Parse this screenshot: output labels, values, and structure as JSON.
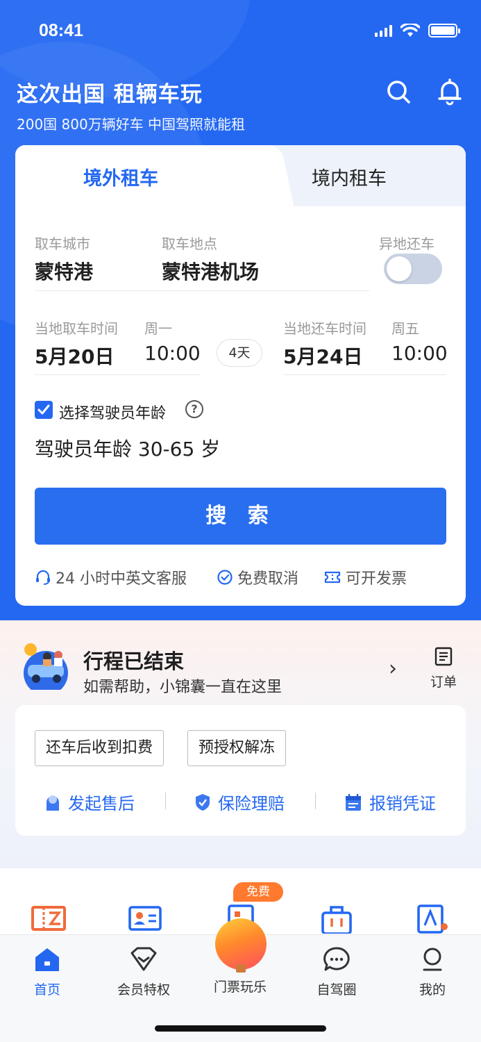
{
  "status": {
    "time": "08:41"
  },
  "header": {
    "title": "这次出国 租辆车玩",
    "subtitle": "200国 800万辆好车 中国驾照就能租"
  },
  "tabs": {
    "overseas": "境外租车",
    "domestic": "境内租车"
  },
  "form": {
    "city_label": "取车城市",
    "city_value": "蒙特港",
    "location_label": "取车地点",
    "location_value": "蒙特港机场",
    "diff_return_label": "异地还车",
    "diff_return_on": false,
    "pickup_time_label": "当地取车时间",
    "pickup_weekday": "周一",
    "pickup_date": "5月20日",
    "pickup_time": "10:00",
    "duration": "4天",
    "return_time_label": "当地还车时间",
    "return_weekday": "周五",
    "return_date": "5月24日",
    "return_time": "10:00",
    "age_checkbox_label": "选择驾驶员年龄",
    "age_checked": true,
    "age_text": "驾驶员年龄 30-65 岁",
    "search_label": "搜 索"
  },
  "features": [
    {
      "icon": "headset-icon",
      "label": "24 小时中英文客服"
    },
    {
      "icon": "check-circle-icon",
      "label": "免费取消"
    },
    {
      "icon": "ticket-icon",
      "label": "可开发票"
    }
  ],
  "trip": {
    "title": "行程已结束",
    "subtitle": "如需帮助，小锦囊一直在这里",
    "order_label": "订单",
    "pills": [
      "还车后收到扣费",
      "预授权解冻"
    ],
    "actions": [
      {
        "icon": "service-icon",
        "label": "发起售后"
      },
      {
        "icon": "shield-icon",
        "label": "保险理赔"
      },
      {
        "icon": "receipt-icon",
        "label": "报销凭证"
      }
    ]
  },
  "promo_badge": "免费",
  "nav": [
    {
      "label": "首页",
      "icon": "home-icon",
      "active": true
    },
    {
      "label": "会员特权",
      "icon": "diamond-icon",
      "active": false
    },
    {
      "label": "门票玩乐",
      "icon": "balloon-icon",
      "active": false
    },
    {
      "label": "自驾圈",
      "icon": "chat-icon",
      "active": false
    },
    {
      "label": "我的",
      "icon": "user-icon",
      "active": false
    }
  ],
  "colors": {
    "brand": "#2468f2",
    "accent": "#ff7a2e"
  }
}
